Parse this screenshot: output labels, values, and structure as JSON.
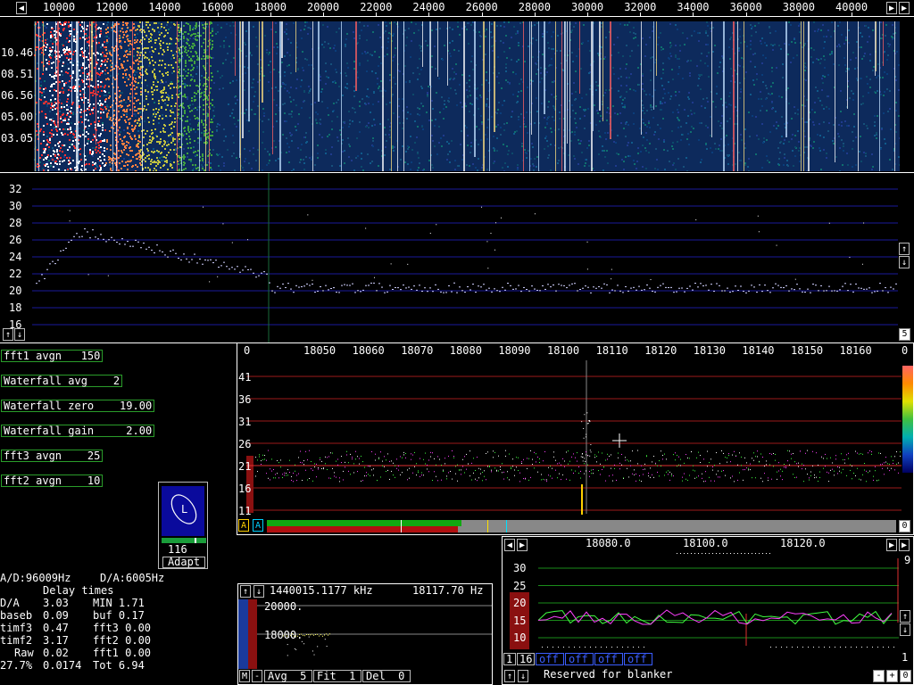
{
  "top_scale": {
    "ticks": [
      "10000",
      "12000",
      "14000",
      "16000",
      "18000",
      "20000",
      "22000",
      "24000",
      "26000",
      "28000",
      "30000",
      "32000",
      "34000",
      "36000",
      "38000",
      "40000"
    ]
  },
  "waterfall": {
    "time_labels": [
      "10.46",
      "08.51",
      "06.56",
      "05.00",
      "03.05"
    ]
  },
  "spectrum": {
    "y_ticks": [
      "32",
      "30",
      "28",
      "26",
      "24",
      "22",
      "20",
      "18",
      "16"
    ],
    "scroll_value": "5"
  },
  "params": [
    {
      "label": "fft1 avgn   150"
    },
    {
      "label": "Waterfall avg    2"
    },
    {
      "label": "Waterfall zero    19.00"
    },
    {
      "label": "Waterfall gain     2.00"
    },
    {
      "label": "fft3 avgn    25"
    },
    {
      "label": "fft2 avgn    10"
    }
  ],
  "baseband": {
    "corner_left": "0",
    "corner_right": "0",
    "x_ticks": [
      "18050",
      "18060",
      "18070",
      "18080",
      "18090",
      "18100",
      "18110",
      "18120",
      "18130",
      "18140",
      "18150",
      "18160"
    ],
    "y_ticks": [
      "41",
      "36",
      "31",
      "26",
      "21",
      "16",
      "11"
    ],
    "right_value": "0",
    "buttons": {
      "a1": "A",
      "a2": "A"
    }
  },
  "smeter": {
    "label": "L",
    "value": "116",
    "adapt": "Adapt"
  },
  "timing": {
    "ad": "A/D:96009Hz",
    "da": "D/A:6005Hz",
    "title": "Delay times",
    "rows": [
      [
        "D/A",
        "3.03",
        "MIN 1.71"
      ],
      [
        "baseb",
        "0.09",
        "buf 0.17"
      ],
      [
        "timf3",
        "0.47",
        "fft3 0.00"
      ],
      [
        "timf2",
        "3.17",
        "fft2 0.00"
      ],
      [
        "Raw",
        "0.02",
        "fft1 0.00"
      ],
      [
        "27.7%",
        "0.0174",
        "Tot 6.94"
      ]
    ]
  },
  "freq_panel": {
    "freq": "1440015.1177 kHz",
    "offset": "18117.70 Hz",
    "y_top": "20000.",
    "y_mid": "18000.",
    "buttons": {
      "m": "M",
      "minus": "-",
      "avg": "Avg  5",
      "fit": "Fit  1",
      "del": "Del  0"
    }
  },
  "hires": {
    "x_ticks": [
      "18080.0",
      "18100.0",
      "18120.0"
    ],
    "y_ticks": [
      "30",
      "25",
      "20",
      "15",
      "10"
    ],
    "right_top": "9",
    "right_bottom": "1",
    "controls": {
      "one": "1",
      "sixteen": "16",
      "off": [
        "off",
        "off",
        "off",
        "off"
      ]
    },
    "status": "Reserved for blanker",
    "buttons": {
      "minus": "-",
      "plus": "+",
      "zero": "0"
    }
  },
  "colors": {
    "grid_blue": "#1a1a9c",
    "grid_red": "#9c1a1a",
    "grid_green": "#1a8c1a",
    "param_border": "#2a9d2a"
  }
}
